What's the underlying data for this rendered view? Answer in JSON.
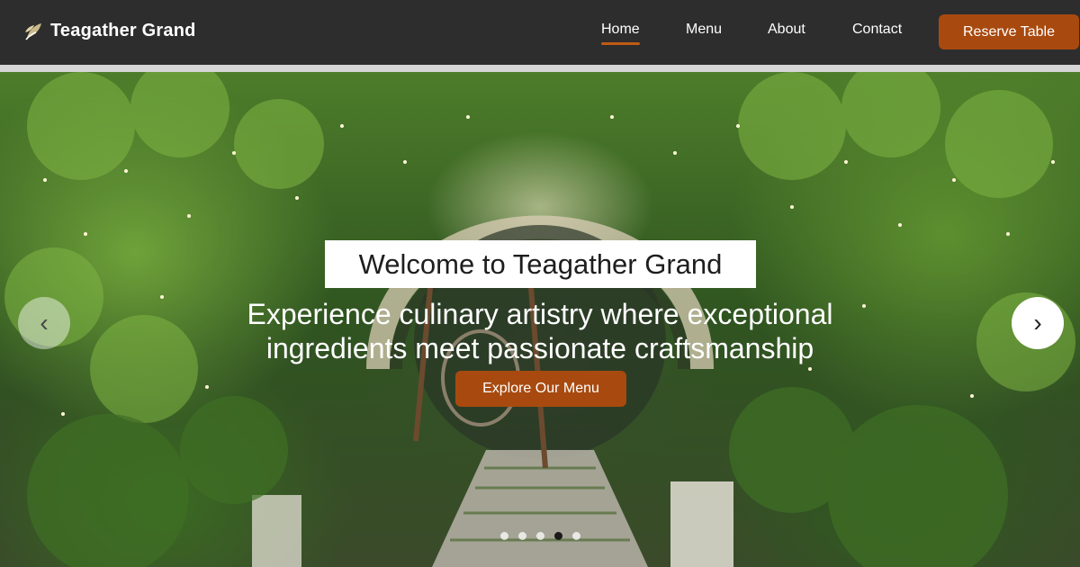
{
  "brand": {
    "name": "Teagather Grand",
    "icon": "leaf-icon"
  },
  "nav": {
    "items": [
      {
        "label": "Home",
        "active": true
      },
      {
        "label": "Menu",
        "active": false
      },
      {
        "label": "About",
        "active": false
      },
      {
        "label": "Contact",
        "active": false
      }
    ],
    "cta_label": "Reserve Table"
  },
  "hero": {
    "title": "Welcome to Teagather Grand",
    "subtitle_line1": "Experience culinary artistry where exceptional",
    "subtitle_line2": "ingredients meet passionate craftsmanship",
    "cta_label": "Explore Our Menu",
    "prev_arrow": "‹",
    "next_arrow": "›",
    "slide_count": 5,
    "active_slide": 4
  },
  "colors": {
    "nav_bg": "#2d2d2d",
    "accent": "#a84a0f",
    "active_underline": "#c05a14"
  }
}
